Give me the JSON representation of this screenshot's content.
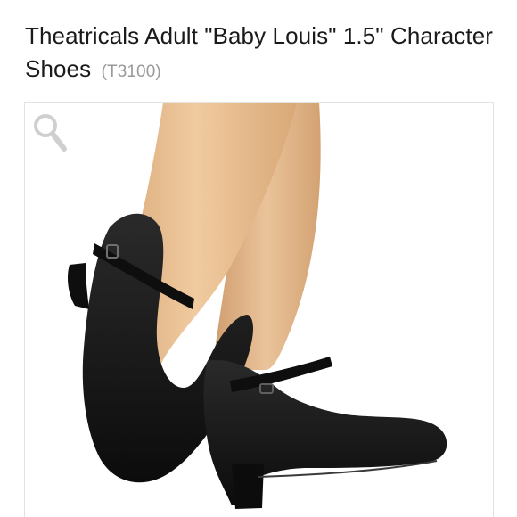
{
  "product": {
    "title": "Theatricals Adult \"Baby Louis\" 1.5\" Character Shoes",
    "sku": "(T3100)"
  },
  "image": {
    "zoom_icon": "magnifier-icon",
    "subject": "shoes-image"
  },
  "colors": {
    "title": "#1a1a1a",
    "sku": "#9a9a9a",
    "frame_border": "#e3e3e3",
    "zoom_icon": "#cfcfcf",
    "leg": "#e3b98c",
    "shoe": "#151515"
  }
}
